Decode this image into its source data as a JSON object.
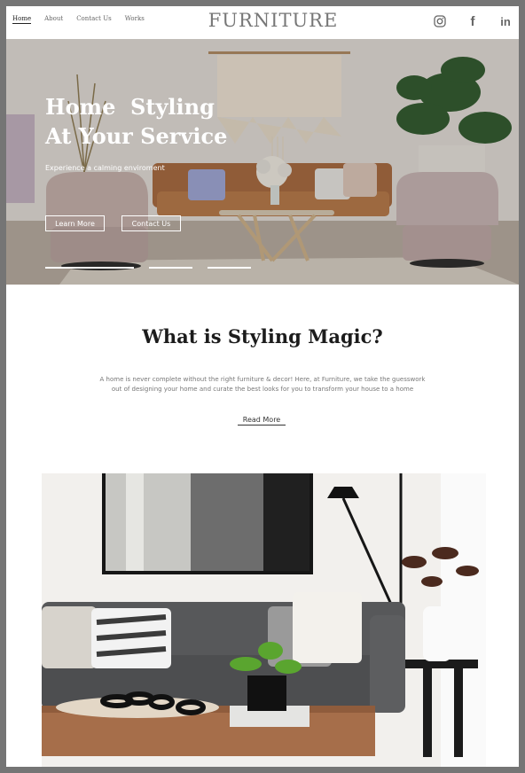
{
  "nav": {
    "items": [
      "Home",
      "About",
      "Contact Us",
      "Works"
    ],
    "active": "Home"
  },
  "brand": {
    "logo": "FURNITURE"
  },
  "social": {
    "icons": [
      "instagram-icon",
      "facebook-icon",
      "linkedin-icon"
    ],
    "facebook_glyph": "f",
    "linkedin_glyph": "in"
  },
  "hero": {
    "title_line1": "Home  Styling",
    "title_line2": "At Your Service",
    "subtitle": "Experience a calming enviroment",
    "learn_more": "Learn More",
    "contact_us": "Contact Us",
    "slide_count": 3,
    "active_slide": 1
  },
  "intro": {
    "title": "What is Styling Magic?",
    "text_line1": "A home is never complete without the right furniture & decor! Here, at Furniture, we take the guesswork",
    "text_line2": "out of designing your home and curate the best looks for you to transform your house to a home",
    "read_more": "Read More"
  },
  "colors": {
    "page_bg": "#757575",
    "text_dark": "#1c1c1c",
    "text_muted": "#777777",
    "white": "#ffffff"
  }
}
